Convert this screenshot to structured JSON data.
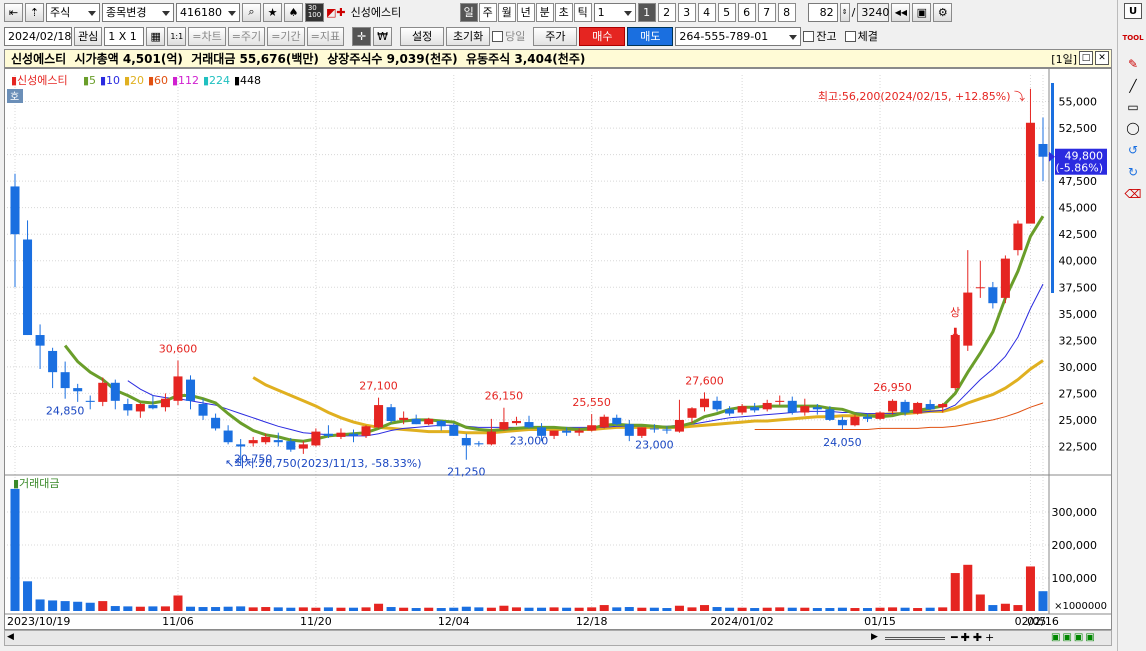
{
  "toolbar1": {
    "market": "주식",
    "change_label": "종목변경",
    "code": "416180",
    "stock_name": "신성에스티",
    "periods": [
      "일",
      "주",
      "월",
      "년",
      "분",
      "초",
      "틱"
    ],
    "interval": "1",
    "pages": [
      "1",
      "2",
      "3",
      "4",
      "5",
      "6",
      "7",
      "8"
    ],
    "count": "82",
    "total": "3240",
    "ticker_icon_text": "30\n100"
  },
  "toolbar2": {
    "date": "2024/02/18",
    "interest": "관심",
    "layout": "1 X 1",
    "one_one": "1:1",
    "chart_label": "=차트",
    "cycle_label": "=주기",
    "period_label": "=기간",
    "indicator_label": "=지표",
    "won": "₩",
    "setting": "설정",
    "reset": "초기화",
    "today": "당일",
    "price": "주가",
    "buy": "매수",
    "sell": "매도",
    "account": "264-555-789-01",
    "balance": "잔고",
    "executed": "체결"
  },
  "info": {
    "text": "신성에스티  시가총액 4,501(억)  거래대금 55,676(백만)  상장주식수 9,039(천주)  유동주식 3,404(천주)",
    "period_tag": "[1일]"
  },
  "chart_data": {
    "type": "candlestick",
    "legend": [
      "신성에스티",
      "5",
      "10",
      "20",
      "60",
      "112",
      "224",
      "448"
    ],
    "legend_colors": [
      "#e52521",
      "#6a9e2a",
      "#2b2be0",
      "#e0b020",
      "#e05010",
      "#d020d0",
      "#20c0c0",
      "#000000"
    ],
    "price_ticks": [
      "55,000",
      "52,500",
      "50,000",
      "47,500",
      "45,000",
      "42,500",
      "40,000",
      "37,500",
      "35,000",
      "32,500",
      "30,000",
      "27,500",
      "25,000",
      "22,500"
    ],
    "volume_ticks": [
      "300,000",
      "200,000",
      "100,000"
    ],
    "volume_unit": "×1000000",
    "volume_label": "거래대금",
    "x_labels": [
      "2023/10/19",
      "11/06",
      "11/20",
      "12/04",
      "12/18",
      "2024/01/02",
      "01/15",
      "02/05",
      "02/16"
    ],
    "annotations": [
      "30,600",
      "24,850",
      "20,750",
      "27,100",
      "26,150",
      "21,250",
      "25,550",
      "23,000",
      "23,000",
      "27,600",
      "24,050",
      "26,950"
    ],
    "high_note": "최고:56,200(2024/02/15, +12.85%)",
    "low_note": "최저:20,750(2023/11/13, -58.33%)",
    "current_price": "49,800",
    "current_change": "(-5.86%)",
    "sang": "상",
    "ho": "호",
    "candles": [
      [
        47000,
        48200,
        37500,
        42500
      ],
      [
        42000,
        43800,
        33000,
        33000
      ],
      [
        33000,
        34000,
        29800,
        32000
      ],
      [
        31500,
        31800,
        28000,
        29500
      ],
      [
        29500,
        30500,
        27000,
        28000
      ],
      [
        28000,
        28400,
        26700,
        27700
      ],
      [
        26800,
        27300,
        26000,
        26700
      ],
      [
        26700,
        29000,
        26300,
        28500
      ],
      [
        28500,
        28800,
        26000,
        26800
      ],
      [
        26500,
        27000,
        25400,
        25900
      ],
      [
        25800,
        26600,
        25200,
        26500
      ],
      [
        26400,
        27300,
        26000,
        26100
      ],
      [
        26200,
        27500,
        25800,
        27000
      ],
      [
        26800,
        30600,
        26400,
        29100
      ],
      [
        28800,
        29200,
        26000,
        26800
      ],
      [
        26500,
        27000,
        25000,
        25400
      ],
      [
        25200,
        25600,
        24000,
        24200
      ],
      [
        24000,
        24500,
        22700,
        22900
      ],
      [
        22700,
        23200,
        20750,
        22500
      ],
      [
        22800,
        23400,
        22500,
        23100
      ],
      [
        22900,
        23700,
        22700,
        23400
      ],
      [
        23100,
        23800,
        22500,
        22900
      ],
      [
        23000,
        23300,
        22000,
        22200
      ],
      [
        22300,
        23000,
        21800,
        22700
      ],
      [
        22600,
        24200,
        22500,
        23900
      ],
      [
        23700,
        24500,
        23300,
        23500
      ],
      [
        23400,
        24200,
        23200,
        23800
      ],
      [
        23700,
        24100,
        22900,
        23500
      ],
      [
        23500,
        24500,
        23300,
        24400
      ],
      [
        24300,
        27100,
        24200,
        26400
      ],
      [
        26200,
        26500,
        24700,
        24900
      ],
      [
        25000,
        25800,
        24600,
        25200
      ],
      [
        25100,
        25500,
        24600,
        24600
      ],
      [
        24600,
        25200,
        24500,
        25100
      ],
      [
        24900,
        25000,
        24000,
        24400
      ],
      [
        24500,
        24700,
        23500,
        23500
      ],
      [
        23300,
        23700,
        21250,
        22600
      ],
      [
        22800,
        23000,
        22500,
        22700
      ],
      [
        22700,
        25100,
        22600,
        23900
      ],
      [
        24100,
        26150,
        24000,
        24800
      ],
      [
        24700,
        25300,
        24500,
        24900
      ],
      [
        24800,
        25400,
        24200,
        24300
      ],
      [
        24300,
        24700,
        23000,
        23500
      ],
      [
        23500,
        24000,
        23200,
        24000
      ],
      [
        24000,
        24300,
        23500,
        23800
      ],
      [
        23800,
        24200,
        23500,
        24000
      ],
      [
        24000,
        25550,
        23900,
        24500
      ],
      [
        24300,
        25500,
        24200,
        25300
      ],
      [
        25200,
        25500,
        24500,
        24600
      ],
      [
        24600,
        25000,
        23000,
        23500
      ],
      [
        23500,
        24300,
        23300,
        24300
      ],
      [
        24200,
        24600,
        23800,
        24100
      ],
      [
        24100,
        24400,
        23700,
        24000
      ],
      [
        23900,
        26900,
        23800,
        25000
      ],
      [
        25200,
        26200,
        24700,
        26100
      ],
      [
        26200,
        27600,
        25800,
        27000
      ],
      [
        26800,
        27200,
        25800,
        26000
      ],
      [
        26000,
        26300,
        25400,
        25600
      ],
      [
        25700,
        26500,
        25500,
        26300
      ],
      [
        26200,
        26600,
        25700,
        25900
      ],
      [
        26000,
        26900,
        25800,
        26600
      ],
      [
        26700,
        27300,
        26400,
        26800
      ],
      [
        26800,
        27200,
        25500,
        25700
      ],
      [
        25700,
        27000,
        25400,
        26300
      ],
      [
        26200,
        26500,
        25500,
        26000
      ],
      [
        26000,
        26300,
        24900,
        25000
      ],
      [
        25000,
        25300,
        24050,
        24500
      ],
      [
        24500,
        25500,
        24400,
        25300
      ],
      [
        25300,
        25600,
        24800,
        25100
      ],
      [
        25100,
        25800,
        25000,
        25700
      ],
      [
        25800,
        26950,
        25500,
        26800
      ],
      [
        26700,
        26900,
        25400,
        25700
      ],
      [
        25600,
        26700,
        25500,
        26600
      ],
      [
        26500,
        26900,
        25900,
        26000
      ],
      [
        26200,
        26600,
        25700,
        26500
      ],
      [
        28000,
        33000,
        27800,
        33000
      ],
      [
        32000,
        41000,
        31500,
        37000
      ],
      [
        37500,
        40000,
        36500,
        37500
      ],
      [
        37500,
        38000,
        35500,
        36000
      ],
      [
        36500,
        40500,
        36000,
        40200
      ],
      [
        41000,
        43800,
        40500,
        43500
      ],
      [
        43500,
        56200,
        45000,
        53000
      ],
      [
        51000,
        53500,
        47500,
        49800
      ]
    ],
    "volumes": [
      370000,
      90000,
      35000,
      32000,
      30000,
      28000,
      25000,
      30000,
      15000,
      14000,
      13000,
      14000,
      14000,
      47000,
      13000,
      12000,
      12000,
      13000,
      14000,
      11000,
      12000,
      11000,
      10000,
      11000,
      10000,
      11000,
      10000,
      10000,
      11000,
      22000,
      12000,
      10000,
      9000,
      10000,
      9000,
      10000,
      13000,
      11000,
      10000,
      16000,
      11000,
      10000,
      10000,
      11000,
      10000,
      10000,
      11000,
      18000,
      11000,
      12000,
      10000,
      10000,
      9000,
      16000,
      11000,
      18000,
      12000,
      10000,
      10000,
      9000,
      10000,
      11000,
      10000,
      10000,
      9000,
      9000,
      10000,
      9000,
      9000,
      10000,
      11000,
      10000,
      9000,
      10000,
      11000,
      115000,
      140000,
      50000,
      18000,
      22000,
      18000,
      135000,
      60000
    ],
    "ma5": [
      null,
      null,
      null,
      null,
      32000,
      30500,
      29500,
      28800,
      27800,
      27300,
      26700,
      26600,
      26800,
      27300,
      27300,
      27000,
      26600,
      25600,
      24700,
      24000,
      23600,
      23400,
      23100,
      23000,
      23200,
      23500,
      23600,
      23700,
      23800,
      24200,
      24700,
      24900,
      25000,
      25000,
      24900,
      24800,
      24300,
      24100,
      24000,
      24100,
      24200,
      24300,
      24300,
      24300,
      24200,
      24100,
      24200,
      24500,
      24600,
      24500,
      24500,
      24400,
      24300,
      24400,
      24700,
      25300,
      25600,
      26000,
      26200,
      26200,
      26300,
      26300,
      26300,
      26300,
      26300,
      26100,
      26000,
      25600,
      25400,
      25300,
      25400,
      25700,
      25900,
      26100,
      26300,
      27500,
      29500,
      31300,
      33300,
      36500,
      39000,
      42300,
      44200
    ],
    "ma20": [
      null,
      null,
      null,
      null,
      null,
      null,
      null,
      null,
      null,
      null,
      null,
      null,
      null,
      null,
      null,
      null,
      null,
      null,
      null,
      29000,
      28300,
      27800,
      27300,
      26800,
      26300,
      25700,
      25200,
      24800,
      24500,
      24300,
      24200,
      24100,
      24000,
      23900,
      23900,
      23900,
      23800,
      23800,
      23800,
      23900,
      24000,
      24100,
      24100,
      24100,
      24100,
      24100,
      24100,
      24200,
      24300,
      24300,
      24300,
      24300,
      24300,
      24300,
      24400,
      24500,
      24600,
      24700,
      24800,
      24900,
      24900,
      25000,
      25100,
      25200,
      25300,
      25300,
      25400,
      25400,
      25500,
      25500,
      25600,
      25600,
      25700,
      25800,
      25800,
      26100,
      26600,
      27000,
      27400,
      28000,
      28800,
      29800,
      30600
    ],
    "ma10": [
      null,
      null,
      null,
      null,
      null,
      null,
      null,
      null,
      null,
      28700,
      27900,
      27300,
      27100,
      27000,
      26800,
      26600,
      26400,
      26000,
      25600,
      25200,
      24800,
      24400,
      24100,
      23800,
      23700,
      23600,
      23500,
      23500,
      23500,
      23700,
      24000,
      24200,
      24300,
      24400,
      24500,
      24500,
      24400,
      24300,
      24300,
      24300,
      24300,
      24300,
      24300,
      24300,
      24300,
      24300,
      24300,
      24300,
      24400,
      24400,
      24400,
      24400,
      24400,
      24500,
      24600,
      24800,
      25000,
      25200,
      25300,
      25400,
      25500,
      25600,
      25700,
      25800,
      25800,
      25800,
      25700,
      25700,
      25600,
      25600,
      25600,
      25700,
      25700,
      25800,
      25900,
      26400,
      27600,
      28800,
      29800,
      31000,
      32800,
      35500,
      37800
    ],
    "ma60": [
      null,
      null,
      null,
      null,
      null,
      null,
      null,
      null,
      null,
      null,
      null,
      null,
      null,
      null,
      null,
      null,
      null,
      null,
      null,
      null,
      null,
      null,
      null,
      null,
      null,
      null,
      null,
      null,
      null,
      null,
      null,
      null,
      null,
      null,
      null,
      null,
      null,
      null,
      null,
      null,
      null,
      null,
      null,
      null,
      null,
      null,
      null,
      null,
      null,
      null,
      null,
      null,
      null,
      null,
      null,
      null,
      null,
      null,
      null,
      24100,
      24100,
      24100,
      24100,
      24100,
      24100,
      24100,
      24100,
      24100,
      24100,
      24200,
      24200,
      24200,
      24200,
      24300,
      24300,
      24400,
      24600,
      24800,
      25000,
      25300,
      25700,
      26200,
      26600
    ],
    "ylim": [
      20000,
      57500
    ],
    "vol_max": 400000
  },
  "colors": {
    "up": "#e52521",
    "down": "#1a6fe0",
    "ma5": "#6a9e2a",
    "ma10": "#2b2be0",
    "ma20": "#e0b020",
    "ma60": "#e05010",
    "buy": "#e52521",
    "sell": "#1a6fe0"
  }
}
